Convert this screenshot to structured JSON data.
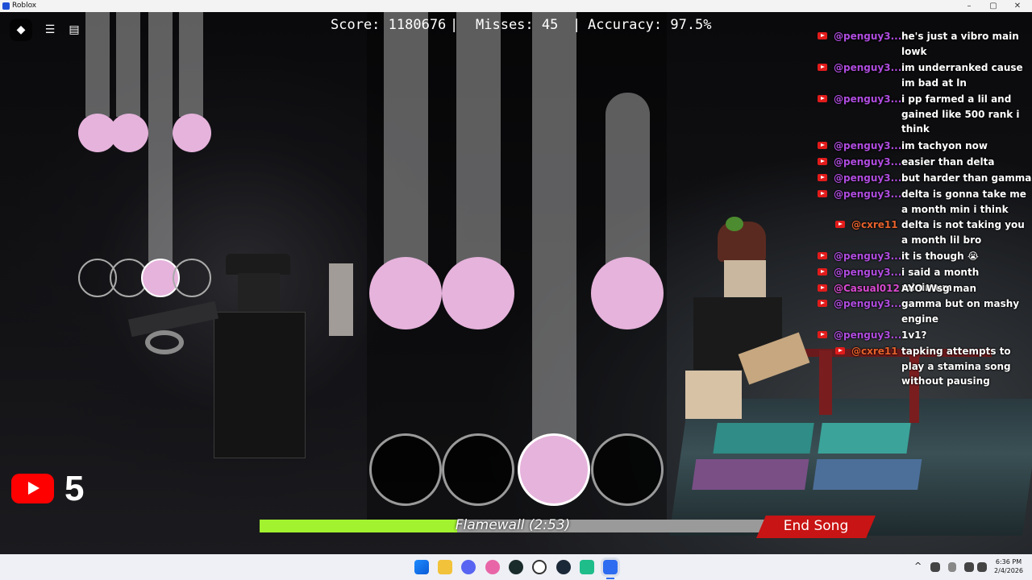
{
  "window": {
    "title": "Roblox",
    "minimize": "–",
    "maximize": "▢",
    "close": "✕"
  },
  "menu": {
    "roblox_icon": "roblox-logo-icon",
    "menu_icon": "hamburger-icon",
    "chat_icon": "chat-bubble-icon"
  },
  "stats": {
    "score": "Score: 1180676",
    "sep1": "|",
    "misses": "Misses: 45",
    "sep2": "|",
    "accuracy": "Accuracy: 97.5%"
  },
  "chat": [
    {
      "user": "@penguy3...",
      "msg": "he's just a vibro main lowk",
      "user_color": "#b04ce0",
      "indent": false
    },
    {
      "user": "@penguy3...",
      "msg": "im underranked cause im bad at ln",
      "user_color": "#b04ce0",
      "indent": false
    },
    {
      "user": "@penguy3...",
      "msg": "i pp farmed a lil and gained like 500 rank i think",
      "user_color": "#b04ce0",
      "indent": false
    },
    {
      "user": "@penguy3...",
      "msg": "im tachyon now",
      "user_color": "#b04ce0",
      "indent": false
    },
    {
      "user": "@penguy3...",
      "msg": "easier than delta",
      "user_color": "#b04ce0",
      "indent": false
    },
    {
      "user": "@penguy3...",
      "msg": "but harder than gamma",
      "user_color": "#b04ce0",
      "indent": false
    },
    {
      "user": "@penguy3...",
      "msg": "delta is gonna take me a month min i think",
      "user_color": "#b04ce0",
      "indent": false
    },
    {
      "user": "@cxre11",
      "msg": "delta is not taking you a month lil bro",
      "user_color": "#e8622c",
      "indent": true
    },
    {
      "user": "@penguy3...",
      "msg": "it is though 😭",
      "user_color": "#b04ce0",
      "indent": false
    },
    {
      "user": "@penguy3...",
      "msg": "i said a month minimum",
      "user_color": "#b04ce0",
      "indent": false
    },
    {
      "user": "@Casual012",
      "msg": "AYO Wsg man",
      "user_color": "#d84ad0",
      "indent": false
    },
    {
      "user": "@penguy3...",
      "msg": "gamma but on mashy engine",
      "user_color": "#b04ce0",
      "indent": false
    },
    {
      "user": "@penguy3...",
      "msg": "1v1?",
      "user_color": "#b04ce0",
      "indent": false
    },
    {
      "user": "@cxre11",
      "msg": "tapking attempts to play a stamina song without pausing",
      "user_color": "#e8622c",
      "indent": true
    }
  ],
  "youtube": {
    "icon": "youtube-logo-icon",
    "count": "5"
  },
  "song": {
    "label": "Flamewall (2:53)",
    "progress": 0.39,
    "end_label": "End Song"
  },
  "colors": {
    "note": "#e6b3dc",
    "progress": "#a2f230",
    "end_button": "#c81414"
  },
  "taskbar": {
    "icons": [
      "windows-start-icon",
      "file-explorer-icon",
      "discord-icon",
      "osu-icon",
      "app-circle-icon",
      "chrome-icon",
      "steam-icon",
      "roblox-studio-icon",
      "roblox-icon"
    ],
    "tray_up": "^",
    "time": "6:36 PM",
    "date": "2/4/2026"
  }
}
